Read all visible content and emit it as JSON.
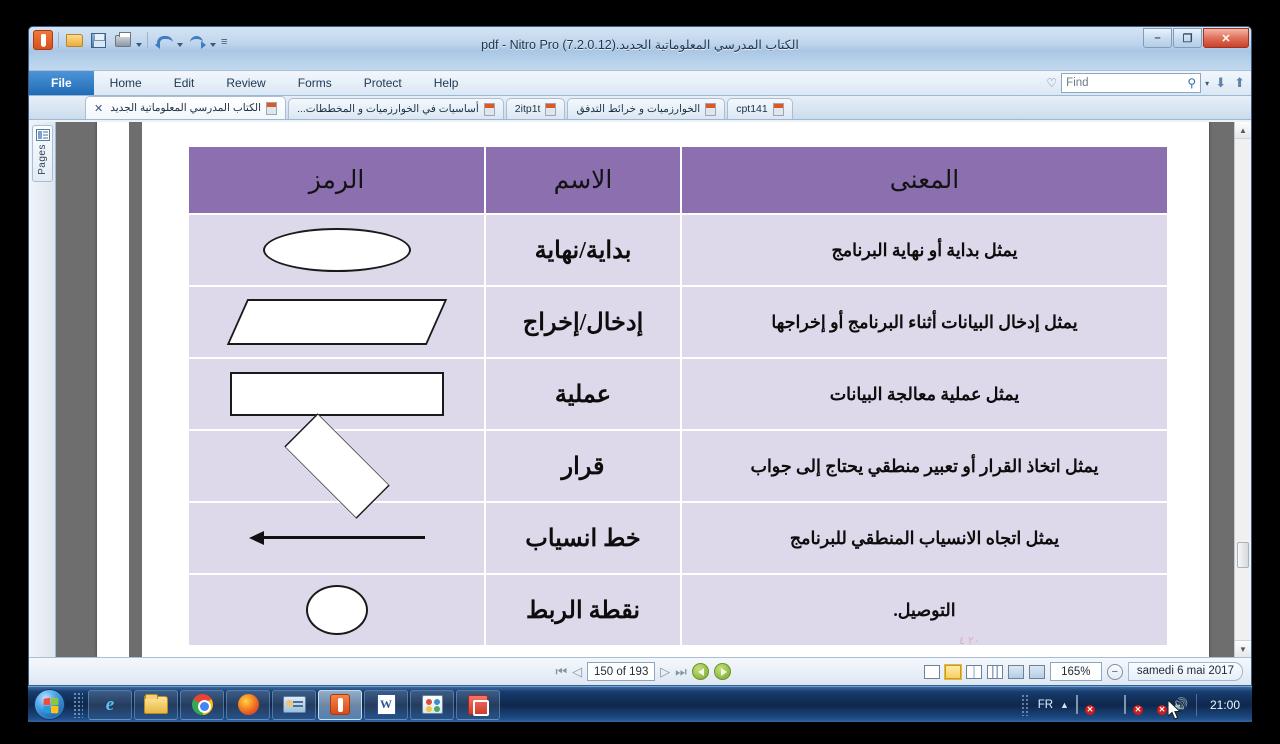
{
  "window": {
    "title": "الكتاب المدرسي المعلوماتية الجديد.pdf - Nitro Pro (7.2.0.12)",
    "minimize_glyph": "–",
    "restore_glyph": "❐",
    "close_glyph": "✕"
  },
  "quick_access": {
    "app_icon": "nitro-orb-icon",
    "buttons": [
      "open-icon",
      "save-icon",
      "print-icon",
      "undo-icon",
      "redo-icon"
    ],
    "more_glyph": "≡"
  },
  "ribbon": {
    "tabs": [
      {
        "label": "File",
        "active": true
      },
      {
        "label": "Home",
        "active": false
      },
      {
        "label": "Edit",
        "active": false
      },
      {
        "label": "Review",
        "active": false
      },
      {
        "label": "Forms",
        "active": false
      },
      {
        "label": "Protect",
        "active": false
      },
      {
        "label": "Help",
        "active": false
      }
    ],
    "find": {
      "placeholder": "Find",
      "value": "",
      "heart_glyph": "♡",
      "magnifier_glyph": "⚲",
      "dropdown_glyph": "▾",
      "prev_glyph": "⬇",
      "next_glyph": "⬆"
    }
  },
  "doc_tabs": [
    {
      "label": "الكتاب المدرسي المعلوماتية الجديد",
      "active": true,
      "close_glyph": "✕"
    },
    {
      "label": "أساسيات في الخوارزميات و المخططات...",
      "active": false,
      "close_glyph": ""
    },
    {
      "label": "2itp1t",
      "active": false,
      "close_glyph": ""
    },
    {
      "label": "الخوارزميات و خرائط التدفق",
      "active": false,
      "close_glyph": ""
    },
    {
      "label": "cpt141",
      "active": false,
      "close_glyph": ""
    }
  ],
  "sidebar": {
    "pages_label": "Pages",
    "pages_icon": "pages-panel-icon"
  },
  "document": {
    "table": {
      "headers": [
        "المعنى",
        "الاسم",
        "الرمز"
      ],
      "header_bg": "#8b6fae",
      "row_bg": "#ded9ea",
      "rows": [
        {
          "meaning": "يمثل بداية أو نهاية البرنامج",
          "name": "بداية/نهاية",
          "symbol": "ellipse"
        },
        {
          "meaning": "يمثل إدخال البيانات أثناء البرنامج أو إخراجها",
          "name": "إدخال/إخراج",
          "symbol": "parallelogram"
        },
        {
          "meaning": "يمثل عملية معالجة البيانات",
          "name": "عملية",
          "symbol": "rectangle"
        },
        {
          "meaning": "يمثل اتخاذ القرار أو تعبير منطقي يحتاج إلى جواب",
          "name": "قرار",
          "symbol": "diamond"
        },
        {
          "meaning": "يمثل اتجاه الانسياب المنطقي للبرنامج",
          "name": "خط انسياب",
          "symbol": "arrow-left"
        },
        {
          "meaning": "التوصيل.",
          "name": "نقطة الربط",
          "symbol": "circle"
        }
      ]
    },
    "page_marks": "٢٠ ٤"
  },
  "statusbar": {
    "first_glyph": "⏮",
    "prev_glyph": "◁",
    "page_value": "150 of 193",
    "next_glyph": "▷",
    "last_glyph": "⏭",
    "scroll_back_glyph": "◀",
    "scroll_fwd_glyph": "▶",
    "view_modes": [
      "single-page-icon",
      "continuous-icon",
      "two-page-icon",
      "four-page-icon",
      "fit-width-icon",
      "fit-page-icon"
    ],
    "zoom_level": "165%",
    "zoom_out_glyph": "−",
    "date": "samedi 6 mai 2017"
  },
  "scrollbar": {
    "up_glyph": "▲",
    "down_glyph": "▼"
  },
  "taskbar": {
    "start": "windows-start-orb",
    "items": [
      {
        "icon": "internet-explorer-icon",
        "active": false
      },
      {
        "icon": "file-explorer-icon",
        "active": false
      },
      {
        "icon": "google-chrome-icon",
        "active": false
      },
      {
        "icon": "firefox-icon",
        "active": false
      },
      {
        "icon": "contacts-icon",
        "active": false
      },
      {
        "icon": "nitro-pro-icon",
        "active": true
      },
      {
        "icon": "microsoft-word-icon",
        "active": false
      },
      {
        "icon": "paint-icon",
        "active": false
      },
      {
        "icon": "powerpoint-icon",
        "active": false
      }
    ],
    "tray": {
      "language": "FR",
      "show_hidden_glyph": "▲",
      "icons": [
        "action-center-flag-icon",
        "antivirus-shield-icon",
        "security-alert-icon",
        "network-icon",
        "volume-icon"
      ],
      "clock": "21:00"
    }
  }
}
